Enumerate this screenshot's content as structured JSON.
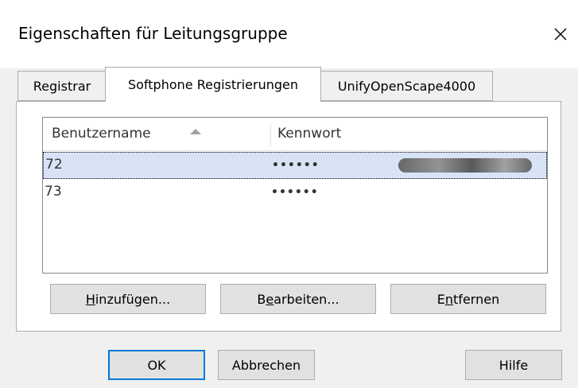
{
  "dialog": {
    "title": "Eigenschaften für Leitungsgruppe"
  },
  "tabs": [
    {
      "label": "Registrar",
      "active": false
    },
    {
      "label": "Softphone Registrierungen",
      "active": true
    },
    {
      "label": "UnifyOpenScape4000",
      "active": false
    }
  ],
  "list": {
    "columns": [
      "Benutzername",
      "Kennwort"
    ],
    "sort_column": "Benutzername",
    "sort_direction": "ascending",
    "rows": [
      {
        "username": "72",
        "password": "••••••",
        "selected": true
      },
      {
        "username": "73",
        "password": "••••••",
        "selected": false
      }
    ]
  },
  "panel_buttons": {
    "add": {
      "pre": "",
      "mnemonic": "H",
      "post": "inzufügen..."
    },
    "edit": {
      "pre": "B",
      "mnemonic": "e",
      "post": "arbeiten..."
    },
    "remove": {
      "pre": "E",
      "mnemonic": "n",
      "post": "tfernen"
    }
  },
  "footer": {
    "ok_label": "OK",
    "cancel_label": "Abbrechen",
    "help_label": "Hilfe"
  },
  "colors": {
    "selection": "#d9e3f6",
    "default_button_border": "#0078d7"
  }
}
